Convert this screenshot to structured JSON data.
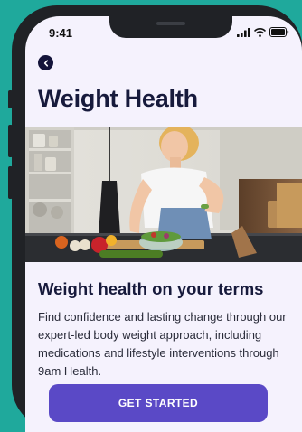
{
  "status_bar": {
    "time": "9:41"
  },
  "header": {
    "title": "Weight Health"
  },
  "hero": {
    "alt": "Woman preparing a fresh salad in a kitchen"
  },
  "content": {
    "heading": "Weight health on your terms",
    "body": "Find confidence and lasting change through our expert-led body weight approach, including medications and lifestyle interventions through 9am Health.",
    "cta_label": "GET STARTED"
  },
  "colors": {
    "background": "#1fa99c",
    "screen": "#f5f2fd",
    "title": "#171a3c",
    "button": "#5a49c6",
    "back_button": "#14143a"
  },
  "icons": [
    "back-chevron-icon",
    "signal-icon",
    "wifi-icon",
    "battery-icon"
  ]
}
